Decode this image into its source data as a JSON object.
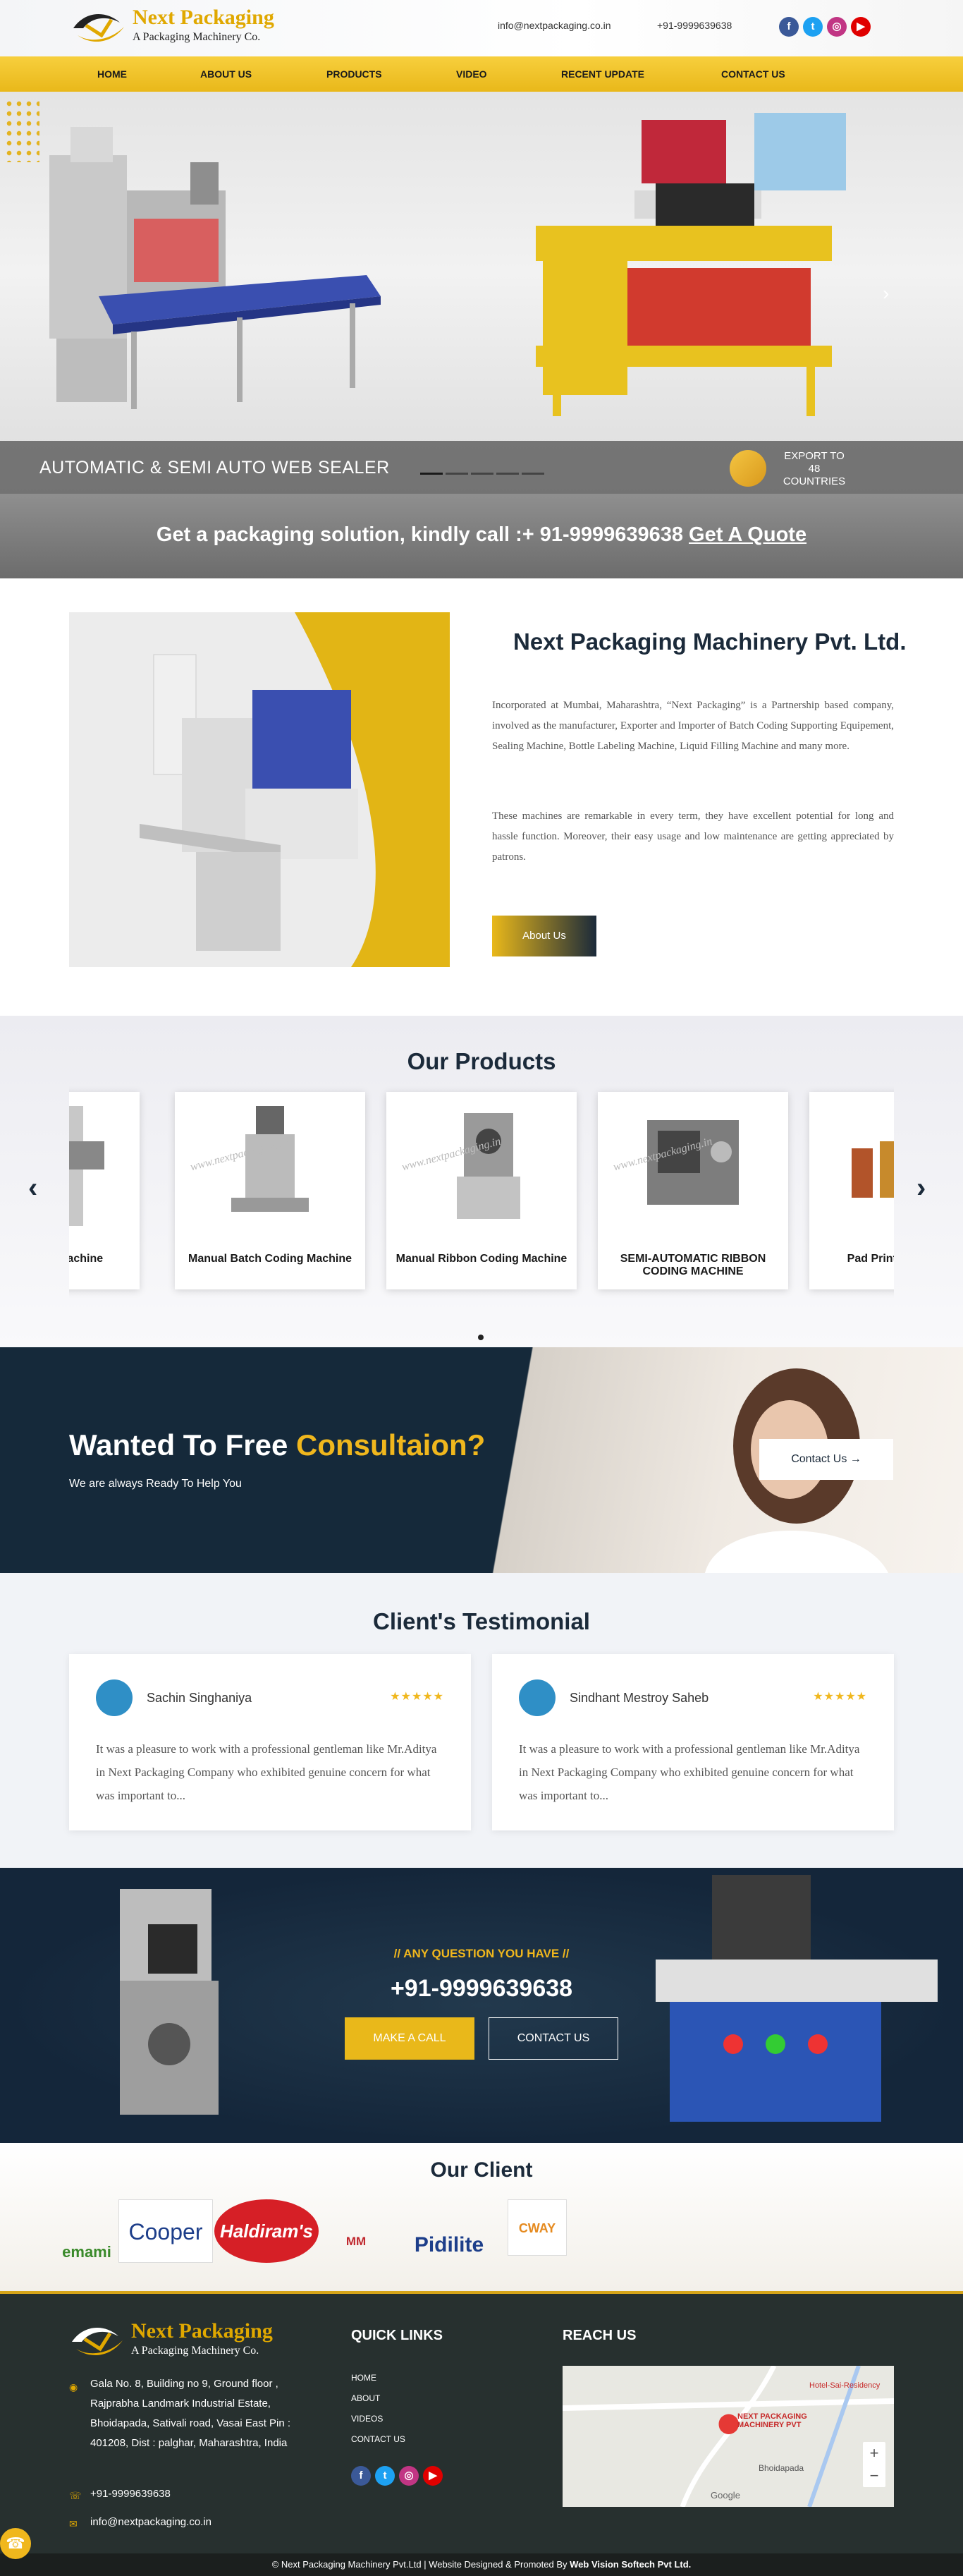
{
  "brand": {
    "name": "Next Packaging",
    "tagline": "A Packaging Machinery Co."
  },
  "header": {
    "email": "info@nextpackaging.co.in",
    "phone": "+91-9999639638"
  },
  "social": [
    {
      "icon": "facebook-icon",
      "glyph": "f",
      "color": "#3b5998"
    },
    {
      "icon": "twitter-icon",
      "glyph": "t",
      "color": "#1da1f2"
    },
    {
      "icon": "instagram-icon",
      "glyph": "◎",
      "color": "#c13584"
    },
    {
      "icon": "youtube-icon",
      "glyph": "▶",
      "color": "#e00000"
    }
  ],
  "nav": [
    "HOME",
    "ABOUT US",
    "PRODUCTS",
    "VIDEO",
    "RECENT UPDATE",
    "CONTACT US"
  ],
  "hero": {
    "caption": "AUTOMATIC & SEMI AUTO WEB SEALER",
    "export": "EXPORT TO 48 COUNTRIES",
    "slides": 5,
    "active_slide": 1
  },
  "quote_band": {
    "text": "Get a packaging solution, kindly call :+ 91-9999639638",
    "link": "Get A Quote"
  },
  "about": {
    "title": "Next Packaging Machinery Pvt. Ltd.",
    "p1": "Incorporated at Mumbai, Maharashtra, “Next Packaging” is a Partnership based company, involved as the manufacturer, Exporter and Importer of Batch Coding Supporting Equipement, Sealing Machine, Bottle Labeling Machine, Liquid Filling Machine and many more.",
    "p2": "These machines are remarkable in every term, they have excellent potential for long and hassle function. Moreover, their easy usage and low maintenance are getting appreciated by patrons.",
    "button": "About Us"
  },
  "products": {
    "title": "Our Products",
    "items": [
      "Auger Filling Machine",
      "Manual Batch Coding Machine",
      "Manual Ribbon Coding Machine",
      "SEMI-AUTOMATIC RIBBON CODING MACHINE",
      "Pad Printing Machine"
    ],
    "watermark": "www.nextpackaging.in"
  },
  "consult": {
    "title_a": "Wanted To Free ",
    "title_b": "Consultaion?",
    "subtitle": "We are always Ready To Help You",
    "button": "Contact Us →"
  },
  "testimonials": {
    "title": "Client's Testimonial",
    "items": [
      {
        "name": "Sachin Singhaniya",
        "stars": "★★★★★",
        "text": "It was a pleasure to work with a professional gentleman like Mr.Aditya in Next Packaging Company who exhibited genuine concern for what was important to..."
      },
      {
        "name": "Sindhant Mestroy Saheb",
        "stars": "★★★★★",
        "text": "It was a pleasure to work with a professional gentleman like Mr.Aditya in Next Packaging Company who exhibited genuine concern for what was important to..."
      }
    ]
  },
  "question": {
    "label": "// ANY QUESTION YOU HAVE //",
    "phone": "+91-9999639638",
    "b1": "MAKE A CALL",
    "b2": "CONTACT US"
  },
  "clients": {
    "title": "Our Client",
    "logos": [
      "emami",
      "Cooper",
      "Haldiram's",
      "MM MITHAIWALA",
      "Pidilite",
      "CWAY"
    ]
  },
  "footer": {
    "quick_title": "QUICK LINKS",
    "reach_title": "REACH US",
    "links": [
      "HOME",
      "ABOUT",
      "VIDEOS",
      "CONTACT US"
    ],
    "address": "Gala No. 8, Building no 9, Ground floor , Rajprabha Landmark Industrial Estate, Bhoidapada, Sativali road, Vasai East Pin : 401208, Dist : palghar, Maharashtra, India",
    "phone": "+91-9999639638",
    "email": "info@nextpackaging.co.in",
    "map_pin": "NEXT PACKAGING MACHINERY PVT",
    "map_place": "Bhoidapada",
    "map_hotel": "Hotel-Sai-Residency",
    "map_google": "Google"
  },
  "copyright": {
    "text": "© Next Packaging Machinery Pvt.Ltd | Website Designed & Promoted By ",
    "by": "Web Vision Softech Pvt Ltd."
  }
}
